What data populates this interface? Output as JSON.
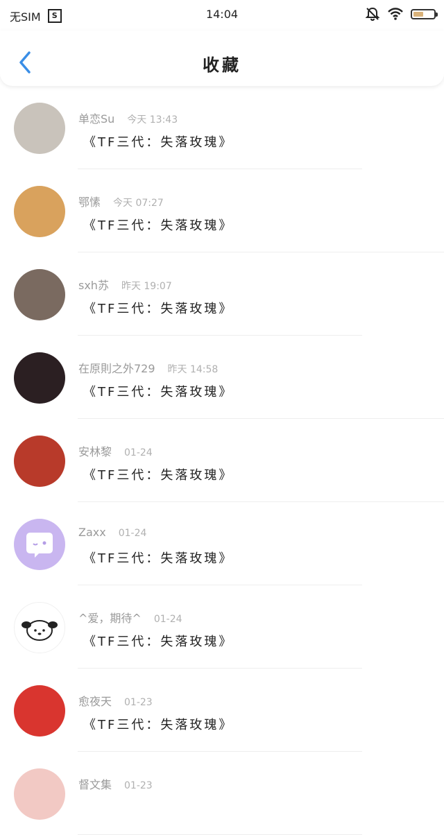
{
  "status_bar": {
    "sim": "无SIM",
    "sim_box": "S",
    "time": "14:04",
    "icons": [
      "bell-off-icon",
      "wifi-icon",
      "battery-icon"
    ]
  },
  "nav": {
    "title": "收藏",
    "back_icon": "chevron-left-icon",
    "accent": "#3a8ee6"
  },
  "favorites": [
    {
      "user": "单恋Su",
      "time": "今天 13:43",
      "title": "《TF三代：失落玫瑰》",
      "avatar_color": "#c9c3bb"
    },
    {
      "user": "鄂愫",
      "time": "今天 07:27",
      "title": "《TF三代：失落玫瑰》",
      "avatar_color": "#d9a25d"
    },
    {
      "user": "sxh苏",
      "time": "昨天 19:07",
      "title": "《TF三代：失落玫瑰》",
      "avatar_color": "#7a6a60"
    },
    {
      "user": "在原則之外729",
      "time": "昨天 14:58",
      "title": "《TF三代：失落玫瑰》",
      "avatar_color": "#2b1f22"
    },
    {
      "user": "安林黎",
      "time": "01-24",
      "title": "《TF三代：失落玫瑰》",
      "avatar_color": "#b83a2a"
    },
    {
      "user": "Zaxx",
      "time": "01-24",
      "title": "《TF三代：失落玫瑰》",
      "avatar_color": "#c9b6f0"
    },
    {
      "user": "^爱，期待^",
      "time": "01-24",
      "title": "《TF三代：失落玫瑰》",
      "avatar_color": "#ffffff"
    },
    {
      "user": "愈夜天",
      "time": "01-23",
      "title": "《TF三代：失落玫瑰》",
      "avatar_color": "#d9352f"
    },
    {
      "user": "督文集",
      "time": "01-23",
      "title": "",
      "avatar_color": "#f2c9c4"
    }
  ]
}
